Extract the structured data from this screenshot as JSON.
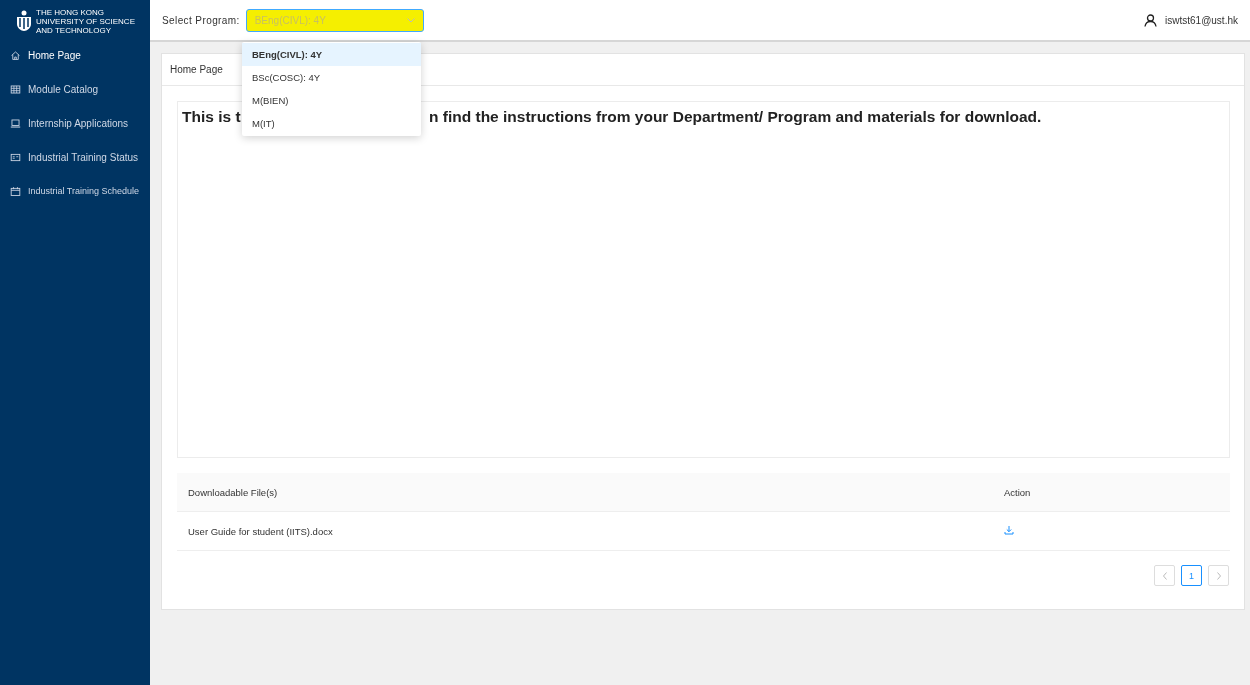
{
  "logo": {
    "lines": [
      "THE HONG KONG",
      "UNIVERSITY OF SCIENCE",
      "AND TECHNOLOGY"
    ]
  },
  "sidebar": {
    "items": [
      {
        "label": "Home Page",
        "selected": true
      },
      {
        "label": "Module Catalog",
        "selected": false
      },
      {
        "label": "Internship Applications",
        "selected": false
      },
      {
        "label": "Industrial Training Status",
        "selected": false
      },
      {
        "label": "Industrial Training Schedule",
        "selected": false
      }
    ]
  },
  "header": {
    "select_label": "Select Program:",
    "select_value": "BEng(CIVL): 4Y",
    "highlighted": true,
    "user": "iswtst61@ust.hk"
  },
  "dropdown": {
    "options": [
      {
        "label": "BEng(CIVL): 4Y",
        "selected": true
      },
      {
        "label": "BSc(COSC): 4Y",
        "selected": false
      },
      {
        "label": "M(BIEN)",
        "selected": false
      },
      {
        "label": "M(IT)",
        "selected": false
      }
    ]
  },
  "card": {
    "tab": "Home Page",
    "message_parts": [
      "This is t",
      "n find the instructions from your Department/ Program and materials for download."
    ]
  },
  "table": {
    "columns": [
      "Downloadable File(s)",
      "Action"
    ],
    "rows": [
      {
        "file": "User Guide for student (IITS).docx"
      }
    ]
  },
  "pagination": {
    "pages": [
      {
        "label": "1",
        "selected": true
      }
    ]
  }
}
